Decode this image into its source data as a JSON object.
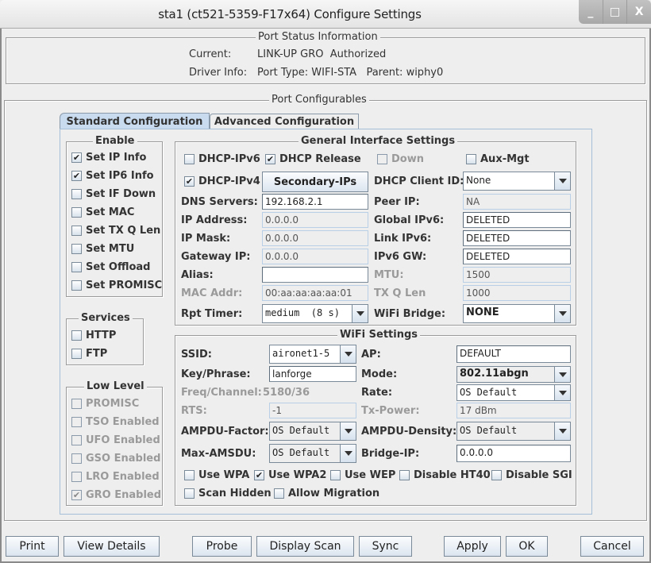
{
  "window": {
    "title": "sta1  (ct521-5359-F17x64) Configure Settings",
    "controls": {
      "minimize": "_",
      "maximize": "□",
      "close": "X"
    }
  },
  "port_status": {
    "title": "Port Status Information",
    "current_label": "Current:",
    "current_value": "LINK-UP GRO  Authorized",
    "driver_label": "Driver Info:",
    "driver_value": "Port Type: WIFI-STA   Parent: wiphy0"
  },
  "configurables": {
    "title": "Port Configurables",
    "tabs": [
      {
        "label": "Standard Configuration",
        "active": true
      },
      {
        "label": "Advanced Configuration",
        "active": false
      }
    ]
  },
  "enable": {
    "title": "Enable",
    "items": [
      {
        "label": "Set IP Info",
        "checked": true
      },
      {
        "label": "Set IP6 Info",
        "checked": true
      },
      {
        "label": "Set IF Down",
        "checked": false
      },
      {
        "label": "Set MAC",
        "checked": false
      },
      {
        "label": "Set TX Q Len",
        "checked": false
      },
      {
        "label": "Set MTU",
        "checked": false
      },
      {
        "label": "Set Offload",
        "checked": false
      },
      {
        "label": "Set PROMISC",
        "checked": false
      }
    ]
  },
  "services": {
    "title": "Services",
    "items": [
      {
        "label": "HTTP",
        "checked": false
      },
      {
        "label": "FTP",
        "checked": false
      }
    ]
  },
  "low_level": {
    "title": "Low Level",
    "items": [
      {
        "label": "PROMISC",
        "checked": false
      },
      {
        "label": "TSO Enabled",
        "checked": false
      },
      {
        "label": "UFO Enabled",
        "checked": false
      },
      {
        "label": "GSO Enabled",
        "checked": false
      },
      {
        "label": "LRO Enabled",
        "checked": false
      },
      {
        "label": "GRO Enabled",
        "checked": true
      }
    ]
  },
  "general": {
    "title": "General Interface Settings",
    "dhcp_ipv6": {
      "label": "DHCP-IPv6",
      "checked": false
    },
    "dhcp_release": {
      "label": "DHCP Release",
      "checked": true
    },
    "down": {
      "label": "Down",
      "checked": false
    },
    "aux_mgt": {
      "label": "Aux-Mgt",
      "checked": false
    },
    "dhcp_ipv4": {
      "label": "DHCP-IPv4",
      "checked": true
    },
    "secondary_ips": "Secondary-IPs",
    "dhcp_client_id": {
      "label": "DHCP Client ID:",
      "value": "None"
    },
    "dns_servers": {
      "label": "DNS Servers:",
      "value": "192.168.2.1"
    },
    "peer_ip": {
      "label": "Peer IP:",
      "value": "NA"
    },
    "ip_address": {
      "label": "IP Address:",
      "value": "0.0.0.0"
    },
    "global_ipv6": {
      "label": "Global IPv6:",
      "value": "DELETED"
    },
    "ip_mask": {
      "label": "IP Mask:",
      "value": "0.0.0.0"
    },
    "link_ipv6": {
      "label": "Link IPv6:",
      "value": "DELETED"
    },
    "gateway_ip": {
      "label": "Gateway IP:",
      "value": "0.0.0.0"
    },
    "ipv6_gw": {
      "label": "IPv6 GW:",
      "value": "DELETED"
    },
    "alias": {
      "label": "Alias:",
      "value": ""
    },
    "mtu": {
      "label": "MTU:",
      "value": "1500"
    },
    "mac_addr": {
      "label": "MAC Addr:",
      "value": "00:aa:aa:aa:aa:01"
    },
    "tx_q_len": {
      "label": "TX Q Len",
      "value": "1000"
    },
    "rpt_timer": {
      "label": "Rpt Timer:",
      "value": "medium  (8 s)"
    },
    "wifi_bridge": {
      "label": "WiFi Bridge:",
      "value": "NONE"
    }
  },
  "wifi": {
    "title": "WiFi Settings",
    "ssid": {
      "label": "SSID:",
      "value": "aironet1-5"
    },
    "ap": {
      "label": "AP:",
      "value": "DEFAULT"
    },
    "key": {
      "label": "Key/Phrase:",
      "value": "lanforge"
    },
    "mode": {
      "label": "Mode:",
      "value": "802.11abgn"
    },
    "freq": {
      "label": "Freq/Channel:",
      "value": "5180/36"
    },
    "rate": {
      "label": "Rate:",
      "value": "OS Default"
    },
    "rts": {
      "label": "RTS:",
      "value": "-1"
    },
    "tx_power": {
      "label": "Tx-Power:",
      "value": "17 dBm"
    },
    "ampdu_factor": {
      "label": "AMPDU-Factor:",
      "value": "OS Default"
    },
    "ampdu_density": {
      "label": "AMPDU-Density:",
      "value": "OS Default"
    },
    "max_amsdu": {
      "label": "Max-AMSDU:",
      "value": "OS Default"
    },
    "bridge_ip": {
      "label": "Bridge-IP:",
      "value": "0.0.0.0"
    },
    "options": [
      {
        "label": "Use WPA",
        "checked": false
      },
      {
        "label": "Use WPA2",
        "checked": true
      },
      {
        "label": "Use WEP",
        "checked": false
      },
      {
        "label": "Disable HT40",
        "checked": false
      },
      {
        "label": "Disable SGI",
        "checked": false
      },
      {
        "label": "Scan Hidden",
        "checked": false
      },
      {
        "label": "Allow Migration",
        "checked": false
      }
    ]
  },
  "buttons": {
    "print": "Print",
    "view_details": "View Details",
    "probe": "Probe",
    "display_scan": "Display Scan",
    "sync": "Sync",
    "apply": "Apply",
    "ok": "OK",
    "cancel": "Cancel"
  },
  "check_glyph": "✔"
}
